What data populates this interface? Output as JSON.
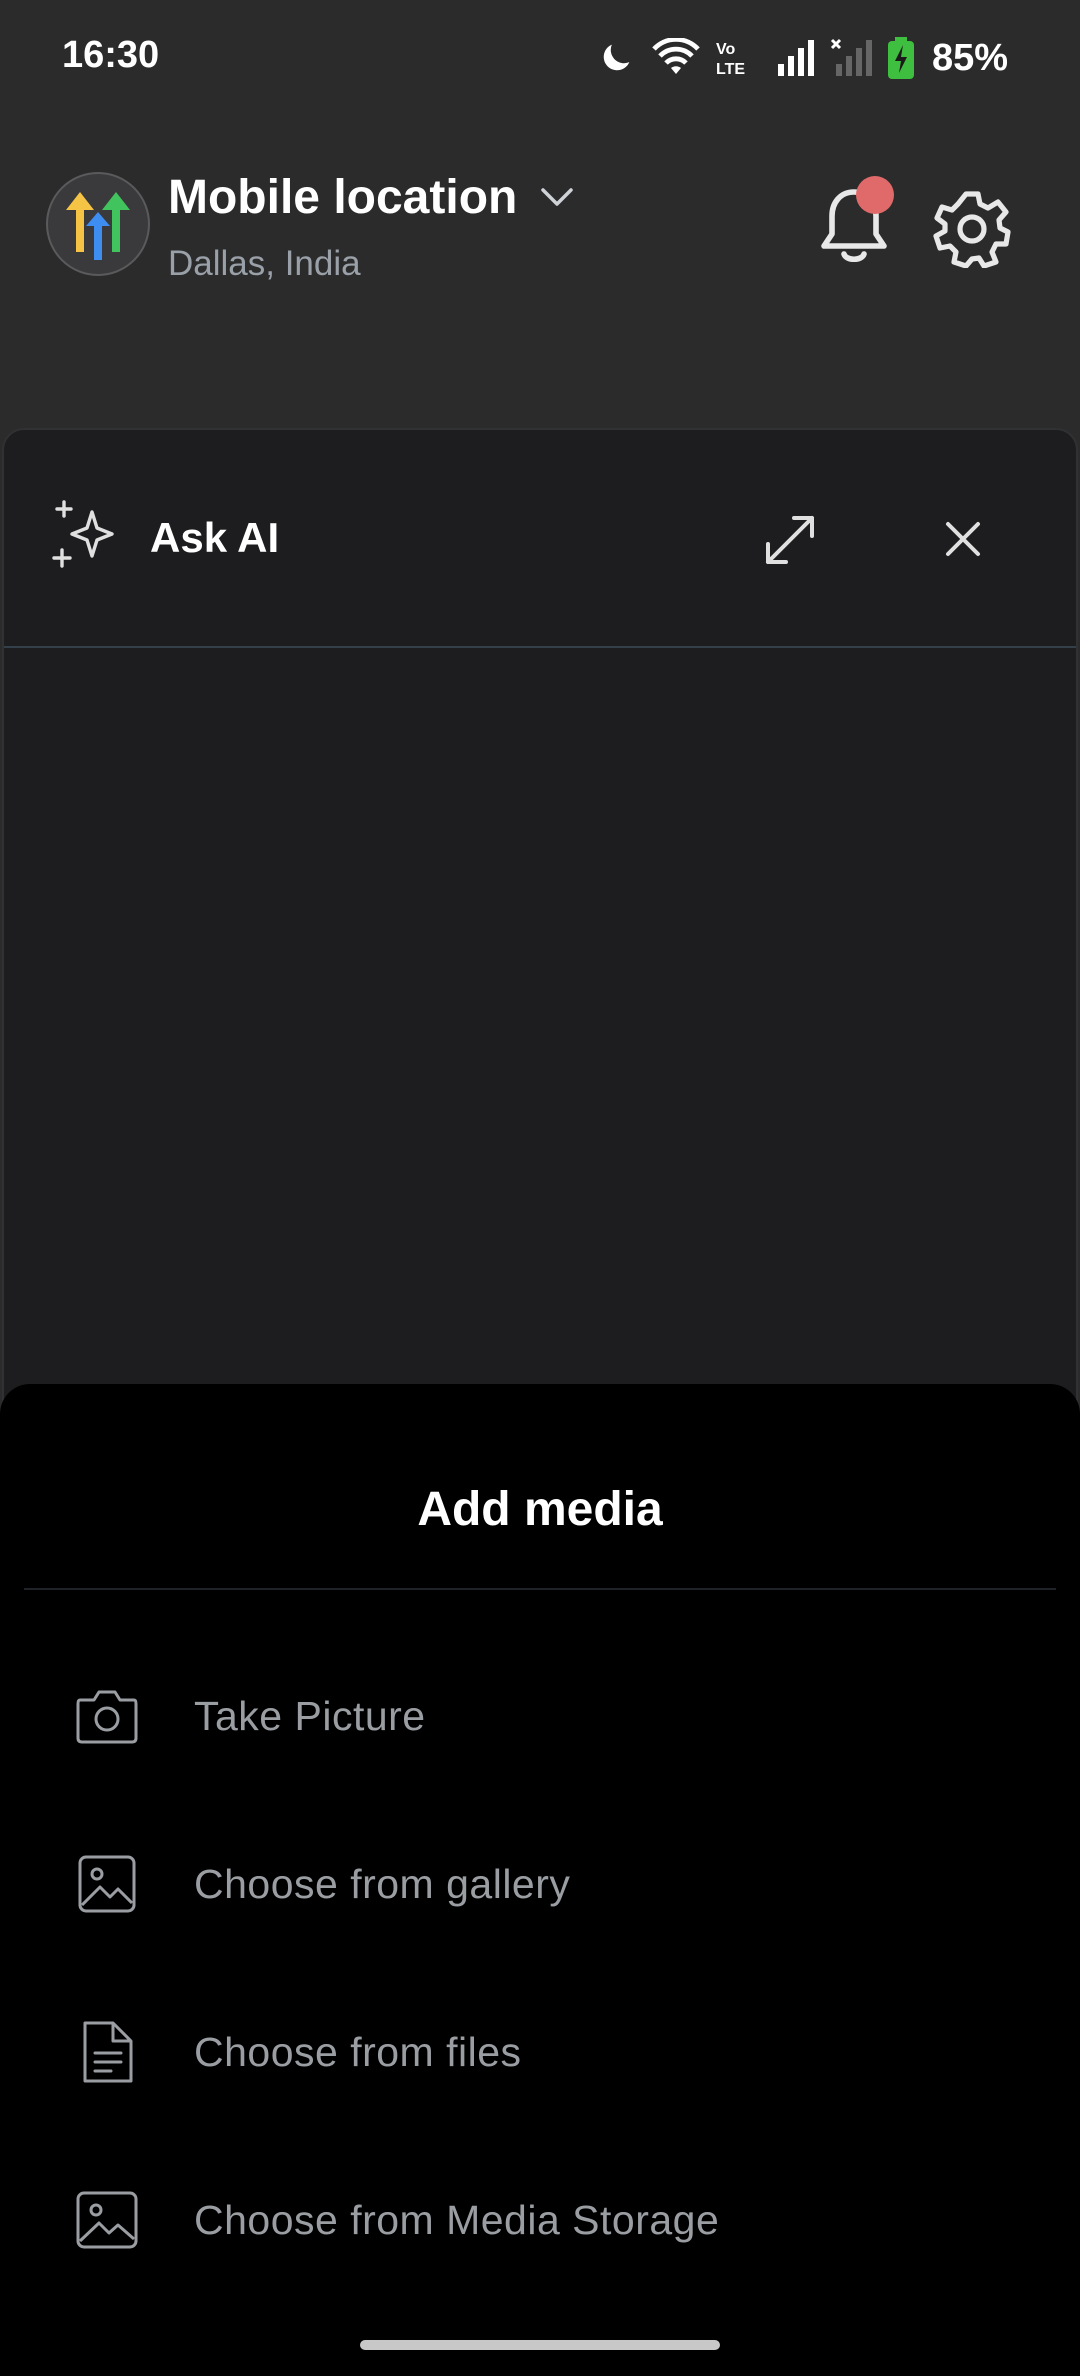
{
  "status_bar": {
    "time": "16:30",
    "battery": "85%",
    "icons": [
      "moon-icon",
      "wifi-icon",
      "volte-icon",
      "signal-icon",
      "signal-no-service-icon",
      "battery-charging-icon"
    ]
  },
  "header": {
    "title": "Mobile location",
    "subtitle": "Dallas, India",
    "logo_icon": "app-logo-arrows",
    "has_notification": true
  },
  "ai_panel": {
    "title": "Ask AI"
  },
  "sheet": {
    "title": "Add media",
    "items": [
      {
        "label": "Take Picture",
        "icon": "camera-icon"
      },
      {
        "label": "Choose from gallery",
        "icon": "image-icon"
      },
      {
        "label": "Choose from files",
        "icon": "file-icon"
      },
      {
        "label": "Choose from Media Storage",
        "icon": "image-icon"
      }
    ]
  },
  "colors": {
    "background": "#2b2b2c",
    "panel": "#1d1d1f",
    "sheet": "#000000",
    "notification_dot": "#e06a6a",
    "battery_green": "#3fbf3f",
    "muted_text": "#9a9ea3"
  }
}
